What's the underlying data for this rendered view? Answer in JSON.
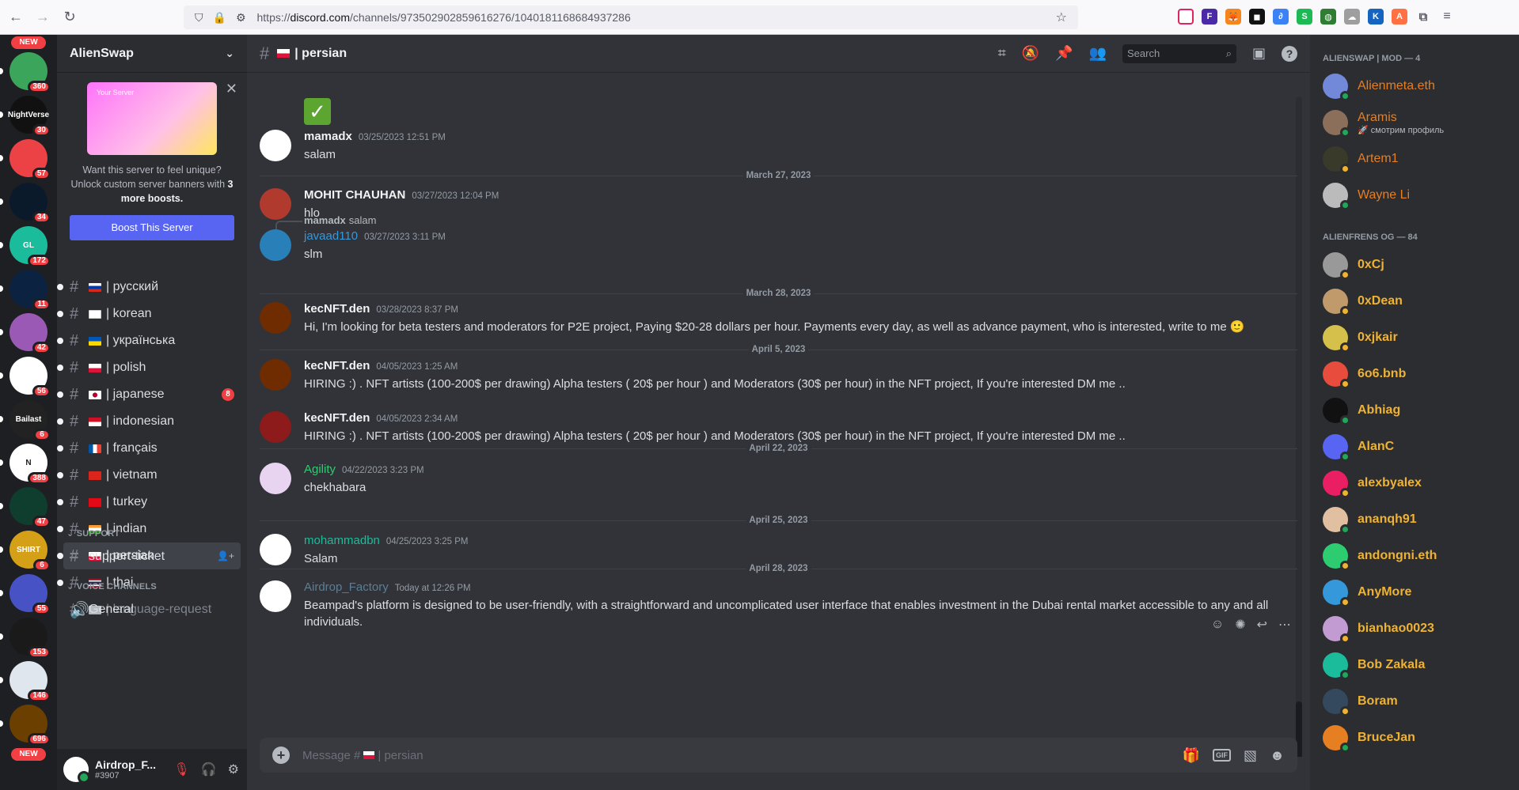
{
  "browser": {
    "url_prefix": "https://",
    "url_domain": "discord.com",
    "url_path": "/channels/973502902859616276/1040181168684937286"
  },
  "guild_bar": {
    "new_label": "NEW",
    "guilds": [
      {
        "badge": "360",
        "color": "#3ba55c",
        "label": ""
      },
      {
        "badge": "30",
        "color": "#111",
        "label": "NightVerse"
      },
      {
        "badge": "57",
        "color": "#ed4245",
        "label": ""
      },
      {
        "badge": "34",
        "color": "#0b1a2a",
        "label": ""
      },
      {
        "badge": "172",
        "color": "#1abc9c",
        "label": "GL"
      },
      {
        "badge": "11",
        "color": "#0b2240",
        "label": ""
      },
      {
        "badge": "42",
        "color": "#9b59b6",
        "label": ""
      },
      {
        "badge": "56",
        "color": "#fff",
        "label": ""
      },
      {
        "badge": "6",
        "color": "#222",
        "label": "Bailast"
      },
      {
        "badge": "388",
        "color": "#fff",
        "label": "N"
      },
      {
        "badge": "47",
        "color": "#0f3d2e",
        "label": ""
      },
      {
        "badge": "6",
        "color": "#d4a017",
        "label": "SHIRT"
      },
      {
        "badge": "55",
        "color": "#4752c4",
        "label": ""
      },
      {
        "badge": "153",
        "color": "#1a1a1a",
        "label": ""
      },
      {
        "badge": "146",
        "color": "#dfe6ee",
        "label": ""
      },
      {
        "badge": "696",
        "color": "#6b3f00",
        "label": ""
      }
    ]
  },
  "server": {
    "name": "AlienSwap",
    "boost_art_label": "Your Server",
    "boost_text_1": "Want this server to feel unique? Unlock custom server banners with ",
    "boost_text_bold": "3 more boosts.",
    "boost_button": "Boost This Server"
  },
  "channels": [
    {
      "flag": "ru",
      "name": "| русский",
      "unread": true
    },
    {
      "flag": "kr",
      "name": "| korean",
      "unread": true
    },
    {
      "flag": "ua",
      "name": "| українська",
      "unread": true
    },
    {
      "flag": "pl",
      "name": "| polish",
      "unread": true
    },
    {
      "flag": "jp",
      "name": "| japanese",
      "unread": true,
      "mention": "8"
    },
    {
      "flag": "id",
      "name": "| indonesian",
      "unread": true
    },
    {
      "flag": "fr",
      "name": "| français",
      "unread": true
    },
    {
      "flag": "vn",
      "name": "| vietnam",
      "unread": true
    },
    {
      "flag": "tr",
      "name": "| turkey",
      "unread": true
    },
    {
      "flag": "in",
      "name": "| indian",
      "unread": true
    },
    {
      "flag": "pl",
      "name": "| persian",
      "active": true,
      "unread": true
    },
    {
      "flag": "th",
      "name": "| thai",
      "unread": true
    },
    {
      "flag": "sp",
      "name": "| language-request",
      "muted": true
    }
  ],
  "categories": {
    "support": "SUPPORT",
    "support_channel": "support-ticket",
    "voice": "VOICE CHANNELS",
    "voice_channel": "General"
  },
  "user_panel": {
    "name": "Airdrop_F...",
    "tag": "#3907"
  },
  "channel_header": {
    "name": "| persian",
    "search_placeholder": "Search"
  },
  "messages": [
    {
      "author": "mamadx",
      "time": "03/25/2023 12:51 PM",
      "text": "salam",
      "author_color": "#f2f3f5"
    },
    {
      "divider": "March 27, 2023"
    },
    {
      "author": "MOHIT CHAUHAN",
      "time": "03/27/2023 12:04 PM",
      "text": "hlo",
      "author_color": "#f2f3f5"
    },
    {
      "reply_author": "mamadx",
      "reply_text": "salam",
      "author": "javaad110",
      "time": "03/27/2023 3:11 PM",
      "text": "slm",
      "author_color": "#3498db"
    },
    {
      "divider": "March 28, 2023"
    },
    {
      "author": "kecNFT.den",
      "time": "03/28/2023 8:37 PM",
      "text": "Hi, I'm looking for beta testers and moderators for P2E project, Paying $20-28 dollars per hour. Payments every day, as well as advance payment, who is interested, write to me 🙂",
      "author_color": "#f2f3f5"
    },
    {
      "divider": "April 5, 2023"
    },
    {
      "author": "kecNFT.den",
      "time": "04/05/2023 1:25 AM",
      "text": "HIRING :) . NFT artists (100-200$ per drawing)  Alpha testers ( 20$ per  hour ) and Moderators (30$ per hour) in the NFT project, If you're interested DM me ..",
      "author_color": "#f2f3f5"
    },
    {
      "author": "kecNFT.den",
      "time": "04/05/2023 2:34 AM",
      "text": "HIRING :) . NFT artists (100-200$ per drawing)  Alpha testers ( 20$ per  hour ) and Moderators (30$ per hour) in the NFT project, If you're interested DM me ..",
      "author_color": "#f2f3f5"
    },
    {
      "divider": "April 22, 2023"
    },
    {
      "author": "Agility",
      "time": "04/22/2023 3:23 PM",
      "text": "chekhabara",
      "author_color": "#2ecc71"
    },
    {
      "divider": "April 25, 2023"
    },
    {
      "author": "mohammadbn",
      "time": "04/25/2023 3:25 PM",
      "text": "Salam",
      "author_color": "#1abc9c"
    },
    {
      "divider": "April 28, 2023"
    },
    {
      "author": "Airdrop_Factory",
      "time": "Today at 12:26 PM",
      "text": "Beampad's platform is designed to be user-friendly, with a straightforward and uncomplicated user interface that enables investment in the Dubai rental market accessible to any and all individuals.",
      "author_color": "#5b7e96"
    }
  ],
  "composer": {
    "placeholder_prefix": "Message #",
    "placeholder_channel": "| persian",
    "gif_label": "GIF"
  },
  "members": {
    "group1": "ALIENSWAP | MOD — 4",
    "mods": [
      {
        "name": "Alienmeta.eth",
        "color": "#7289da",
        "status": "#23a55a",
        "activity": ""
      },
      {
        "name": "Aramis",
        "color": "#8b6f5a",
        "status": "#23a55a",
        "activity": "🚀 смотрим профиль"
      },
      {
        "name": "Artem1",
        "color": "#3a3a2a",
        "status": "#f0b232",
        "activity": ""
      },
      {
        "name": "Wayne Li",
        "color": "#bbb",
        "status": "#23a55a",
        "activity": ""
      }
    ],
    "group2": "ALIENFRENS OG — 84",
    "og": [
      {
        "name": "0xCj",
        "color": "#999",
        "status": "#f0b232"
      },
      {
        "name": "0xDean",
        "color": "#c19a6b",
        "status": "#f0b232"
      },
      {
        "name": "0xjkair",
        "color": "#d4c04a",
        "status": "#f0b232"
      },
      {
        "name": "6o6.bnb",
        "color": "#e74c3c",
        "status": "#f0b232"
      },
      {
        "name": "Abhiag",
        "color": "#111",
        "status": "#23a55a"
      },
      {
        "name": "AlanC",
        "color": "#5865f2",
        "status": "#23a55a"
      },
      {
        "name": "alexbyalex",
        "color": "#e91e63",
        "status": "#f0b232"
      },
      {
        "name": "ananqh91",
        "color": "#e0c0a0",
        "status": "#23a55a"
      },
      {
        "name": "andongni.eth",
        "color": "#2ecc71",
        "status": "#f0b232"
      },
      {
        "name": "AnyMore",
        "color": "#3498db",
        "status": "#f0b232"
      },
      {
        "name": "bianhao0023",
        "color": "#c39bd3",
        "status": "#f0b232"
      },
      {
        "name": "Bob Zakala",
        "color": "#1abc9c",
        "status": "#23a55a"
      },
      {
        "name": "Boram",
        "color": "#34495e",
        "status": "#f0b232"
      },
      {
        "name": "BruceJan",
        "color": "#e67e22",
        "status": "#23a55a"
      }
    ]
  }
}
